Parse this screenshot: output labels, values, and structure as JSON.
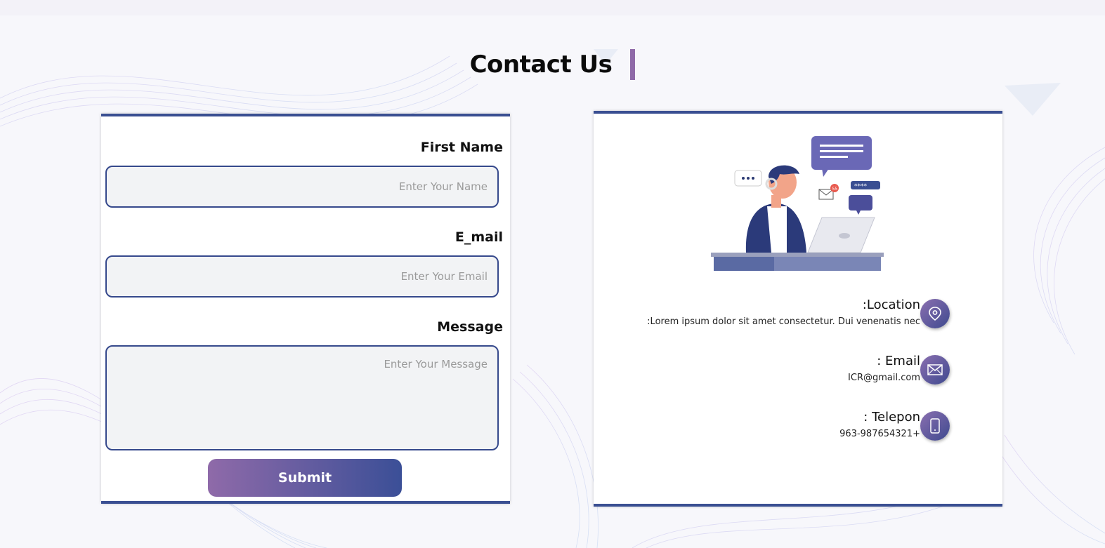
{
  "page": {
    "title": "Contact Us"
  },
  "form": {
    "first_name_label": "First Name",
    "first_name_placeholder": "Enter Your Name",
    "email_label": "E_mail",
    "email_placeholder": "Enter Your Email",
    "message_label": "Message",
    "message_placeholder": "Enter Your Message",
    "submit_label": "Submit"
  },
  "info": {
    "illustration_icon": "support-agent-illustration",
    "location": {
      "label": ":Location",
      "value": ":Lorem ipsum dolor sit amet consectetur. Dui venenatis nec",
      "icon": "location-pin-icon"
    },
    "email": {
      "label": ": Email",
      "value": "ICR@gmail.com",
      "icon": "envelope-icon"
    },
    "phone": {
      "label": ": Telepon",
      "value": "963-987654321+",
      "icon": "phone-icon"
    },
    "illustration_badge": "55",
    "illustration_password": "****"
  },
  "colors": {
    "accent_purple": "#8f6aa9",
    "accent_blue": "#3b4f97",
    "card_border": "#3a4f92"
  }
}
